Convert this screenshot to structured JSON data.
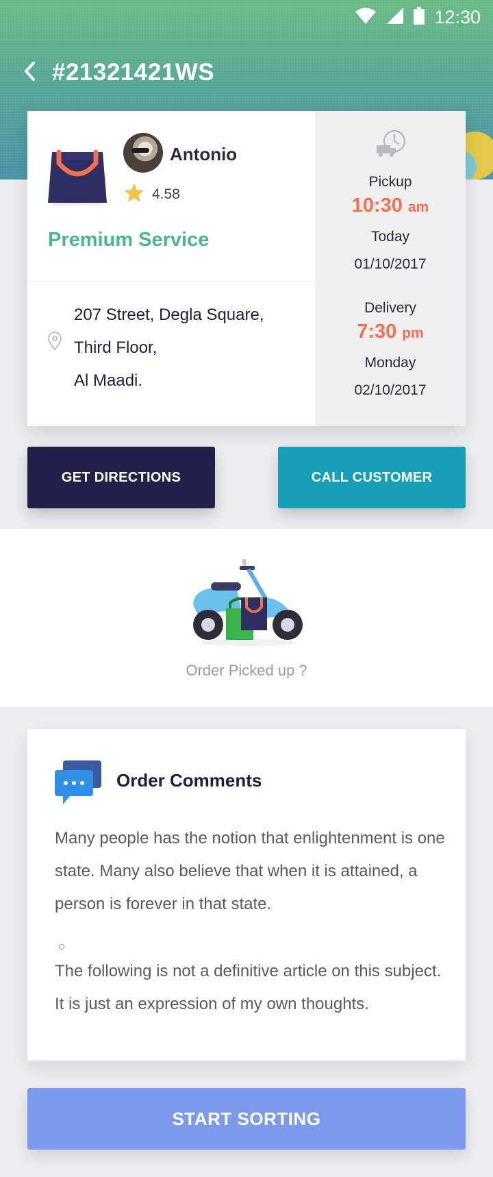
{
  "status_bar": {
    "time": "12:30"
  },
  "header": {
    "order_id": "#21321421WS"
  },
  "order": {
    "customer_name": "Antonio",
    "rating": "4.58",
    "service": "Premium Service",
    "address": [
      "207 Street, Degla Square,",
      "Third Floor,",
      "Al Maadi."
    ],
    "pickup": {
      "label": "Pickup",
      "time": "10:30",
      "ampm": "am",
      "day": "Today",
      "date": "01/10/2017"
    },
    "delivery": {
      "label": "Delivery",
      "time": "7:30",
      "ampm": "pm",
      "day": "Monday",
      "date": "02/10/2017"
    }
  },
  "actions": {
    "directions": "GET DIRECTIONS",
    "call": "CALL CUSTOMER"
  },
  "pickup_prompt": "Order Picked up ?",
  "comments": {
    "title": "Order Comments",
    "paragraph_1": "Many people has the notion that enlightenment is one state. Many also believe that when it is attained, a person is forever in that state.",
    "paragraph_2": "The following is not a definitive article on this subject. It is just an expression of my own thoughts."
  },
  "primary_button": "START SORTING",
  "colors": {
    "accent_orange": "#f0714f",
    "service_green": "#4cb58a",
    "navy": "#23204a",
    "teal": "#169fb6",
    "start_blue": "#7c9aeb"
  }
}
